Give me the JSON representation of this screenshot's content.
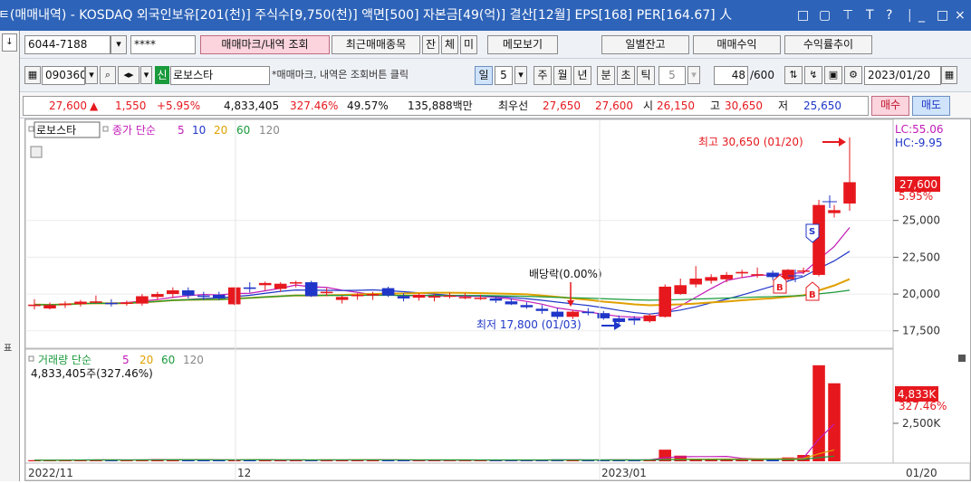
{
  "window": {
    "title": "ㅌ(매매내역) - KOSDAQ 외국인보유[201(천)] 주식수[9,750(천)] 액면[500] 자본금[49(억)] 결산[12월] EPS[168] PER[164.67] 人",
    "controls": [
      "□",
      "▢",
      "⊤",
      "T",
      "?",
      "_",
      "□",
      "×"
    ]
  },
  "toolbar1": {
    "account": "6044-7188",
    "password": "****",
    "btn_mark": "매매마크/내역 조회",
    "btn_recent": "최근매매종목",
    "btn_jan": "잔",
    "btn_che": "체",
    "btn_mi": "미",
    "btn_memo": "메모보기",
    "btn_daily": "일별잔고",
    "btn_profit": "매매수익",
    "btn_yield": "수익률추이"
  },
  "toolbar2": {
    "code": "090360",
    "badge": "신",
    "name": "로보스타",
    "hint": "*매매마크, 내역은 조회버튼 클릭",
    "period": "일",
    "period_n": "5",
    "periods": [
      "주",
      "월",
      "년",
      "분",
      "초",
      "틱"
    ],
    "tick_n": "5",
    "count": "48",
    "total": "/600",
    "date": "2023/01/20"
  },
  "quote": {
    "price": "27,600",
    "change": "1,550",
    "pct": "+5.95%",
    "volume": "4,833,405",
    "vol_ratio": "327.46%",
    "turnover": "49.57%",
    "amount": "135,888백만",
    "best_label": "최우선",
    "ask": "27,650",
    "bid": "27,600",
    "open_label": "시",
    "open": "26,150",
    "high_label": "고",
    "high": "30,650",
    "low_label": "저",
    "low": "25,650",
    "buy": "매수",
    "sell": "매도"
  },
  "chart_data": {
    "type": "candlestick",
    "name": "로보스타",
    "price_legend": {
      "label": "종가 단순",
      "periods": [
        "5",
        "10",
        "20",
        "60",
        "120"
      ]
    },
    "price_axis": {
      "ticks": [
        "25,000",
        "22,500",
        "20,000",
        "17,500"
      ],
      "ylim": [
        16500,
        31500
      ]
    },
    "last_label": {
      "price": "27,600",
      "pct": "5.95%"
    },
    "lc": "LC:55.06",
    "hc": "HC:-9.95",
    "annotations": {
      "high": "최고 30,650 (01/20)",
      "low": "최저 17,800 (01/03)",
      "dividend": "배당락(0.00%)"
    },
    "candles": [
      {
        "o": 19180,
        "h": 19650,
        "l": 18950,
        "c": 19280
      },
      {
        "o": 19020,
        "h": 19420,
        "l": 18950,
        "c": 19250
      },
      {
        "o": 19250,
        "h": 19500,
        "l": 19050,
        "c": 19350
      },
      {
        "o": 19320,
        "h": 19600,
        "l": 19150,
        "c": 19480
      },
      {
        "o": 19500,
        "h": 19900,
        "l": 19350,
        "c": 19500
      },
      {
        "o": 19400,
        "h": 19650,
        "l": 19150,
        "c": 19350
      },
      {
        "o": 19350,
        "h": 19550,
        "l": 19200,
        "c": 19420
      },
      {
        "o": 19350,
        "h": 20000,
        "l": 19200,
        "c": 19850
      },
      {
        "o": 19800,
        "h": 20150,
        "l": 19600,
        "c": 20000
      },
      {
        "o": 20000,
        "h": 20450,
        "l": 19750,
        "c": 20250
      },
      {
        "o": 20250,
        "h": 20450,
        "l": 19700,
        "c": 19900
      },
      {
        "o": 19900,
        "h": 20150,
        "l": 19600,
        "c": 19850
      },
      {
        "o": 19950,
        "h": 20150,
        "l": 19600,
        "c": 19700
      },
      {
        "o": 19300,
        "h": 20450,
        "l": 19250,
        "c": 20450
      },
      {
        "o": 20450,
        "h": 20800,
        "l": 20100,
        "c": 20350
      },
      {
        "o": 20600,
        "h": 20850,
        "l": 20250,
        "c": 20750
      },
      {
        "o": 20350,
        "h": 20800,
        "l": 20150,
        "c": 20700
      },
      {
        "o": 20750,
        "h": 20900,
        "l": 20450,
        "c": 20800
      },
      {
        "o": 20800,
        "h": 20900,
        "l": 19800,
        "c": 19850
      },
      {
        "o": 20150,
        "h": 20400,
        "l": 19850,
        "c": 20150
      },
      {
        "o": 19600,
        "h": 19900,
        "l": 19350,
        "c": 19800
      },
      {
        "o": 19850,
        "h": 20050,
        "l": 19600,
        "c": 19950
      },
      {
        "o": 19900,
        "h": 20150,
        "l": 19600,
        "c": 20000
      },
      {
        "o": 20400,
        "h": 20500,
        "l": 19800,
        "c": 19900
      },
      {
        "o": 19850,
        "h": 20050,
        "l": 19500,
        "c": 19700
      },
      {
        "o": 19750,
        "h": 20050,
        "l": 19550,
        "c": 19950
      },
      {
        "o": 19800,
        "h": 20000,
        "l": 19500,
        "c": 19850
      },
      {
        "o": 19900,
        "h": 20100,
        "l": 19700,
        "c": 19900
      },
      {
        "o": 19800,
        "h": 20050,
        "l": 19650,
        "c": 19800
      },
      {
        "o": 19750,
        "h": 19950,
        "l": 19600,
        "c": 19750
      },
      {
        "o": 19700,
        "h": 19850,
        "l": 19400,
        "c": 19550
      },
      {
        "o": 19500,
        "h": 19700,
        "l": 19250,
        "c": 19300
      },
      {
        "o": 19250,
        "h": 19450,
        "l": 19000,
        "c": 19100
      },
      {
        "o": 19000,
        "h": 19250,
        "l": 18650,
        "c": 18850
      },
      {
        "o": 18800,
        "h": 19050,
        "l": 18300,
        "c": 18450
      },
      {
        "o": 18450,
        "h": 18900,
        "l": 18300,
        "c": 18800
      },
      {
        "o": 18800,
        "h": 19050,
        "l": 18550,
        "c": 18700
      },
      {
        "o": 18700,
        "h": 18850,
        "l": 18250,
        "c": 18350
      },
      {
        "o": 18350,
        "h": 18550,
        "l": 17800,
        "c": 18100
      },
      {
        "o": 18350,
        "h": 18500,
        "l": 17900,
        "c": 18200
      },
      {
        "o": 18150,
        "h": 18650,
        "l": 18050,
        "c": 18550
      },
      {
        "o": 18450,
        "h": 20650,
        "l": 18400,
        "c": 20500
      },
      {
        "o": 20000,
        "h": 21050,
        "l": 19950,
        "c": 20600
      },
      {
        "o": 20650,
        "h": 21900,
        "l": 20450,
        "c": 21050
      },
      {
        "o": 20900,
        "h": 21350,
        "l": 20700,
        "c": 21150
      },
      {
        "o": 21000,
        "h": 21500,
        "l": 20800,
        "c": 21300
      },
      {
        "o": 21400,
        "h": 21650,
        "l": 21100,
        "c": 21500
      },
      {
        "o": 21300,
        "h": 21800,
        "l": 21100,
        "c": 21350
      },
      {
        "o": 21450,
        "h": 21600,
        "l": 20950,
        "c": 21150
      },
      {
        "o": 21000,
        "h": 21700,
        "l": 20950,
        "c": 21650
      },
      {
        "o": 21600,
        "h": 21800,
        "l": 21350,
        "c": 21600
      },
      {
        "o": 21300,
        "h": 26400,
        "l": 21200,
        "c": 26050
      },
      {
        "o": 25500,
        "h": 26050,
        "l": 25200,
        "c": 25700
      },
      {
        "o": 26150,
        "h": 30650,
        "l": 25650,
        "c": 27600
      }
    ],
    "volume_panel": {
      "label": "거래량 단순",
      "periods": [
        "5",
        "20",
        "60",
        "120"
      ],
      "info": "4,833,405주(327.46%)",
      "last": "4,833K",
      "pct": "327.46%",
      "axis_tick": "2,500K",
      "ylim": [
        0,
        6500
      ],
      "values": [
        70,
        60,
        90,
        100,
        110,
        75,
        65,
        90,
        140,
        110,
        75,
        85,
        65,
        95,
        120,
        80,
        70,
        60,
        75,
        120,
        90,
        70,
        95,
        80,
        75,
        65,
        70,
        60,
        95,
        80,
        60,
        70,
        85,
        80,
        120,
        95,
        60,
        80,
        90,
        110,
        120,
        720,
        350,
        160,
        110,
        160,
        150,
        130,
        140,
        240,
        390,
        5950,
        4833
      ]
    },
    "x_labels": [
      "2022/11",
      "12",
      "2023/01",
      "01/20"
    ]
  }
}
